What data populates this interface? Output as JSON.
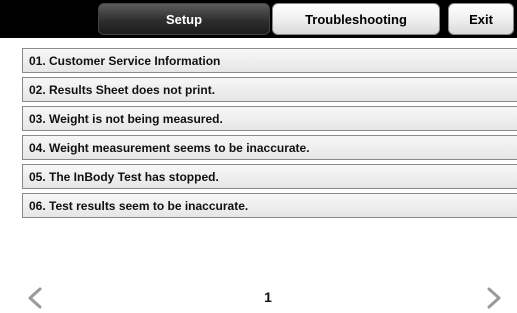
{
  "tabs": {
    "setup": "Setup",
    "troubleshooting": "Troubleshooting",
    "exit": "Exit"
  },
  "items": [
    "01. Customer Service Information",
    "02. Results Sheet does not print.",
    "03. Weight is not being measured.",
    "04. Weight measurement seems to be inaccurate.",
    "05. The InBody Test has stopped.",
    "06. Test results seem to be inaccurate."
  ],
  "pager": {
    "page": "1",
    "prev_icon": "chevron-left-icon",
    "next_icon": "chevron-right-icon",
    "arrow_color": "#9a9a9a"
  },
  "colors": {
    "topbar": "#000000",
    "active_tab": "#eeeeee",
    "inactive_tab": "#2e2e2e"
  }
}
